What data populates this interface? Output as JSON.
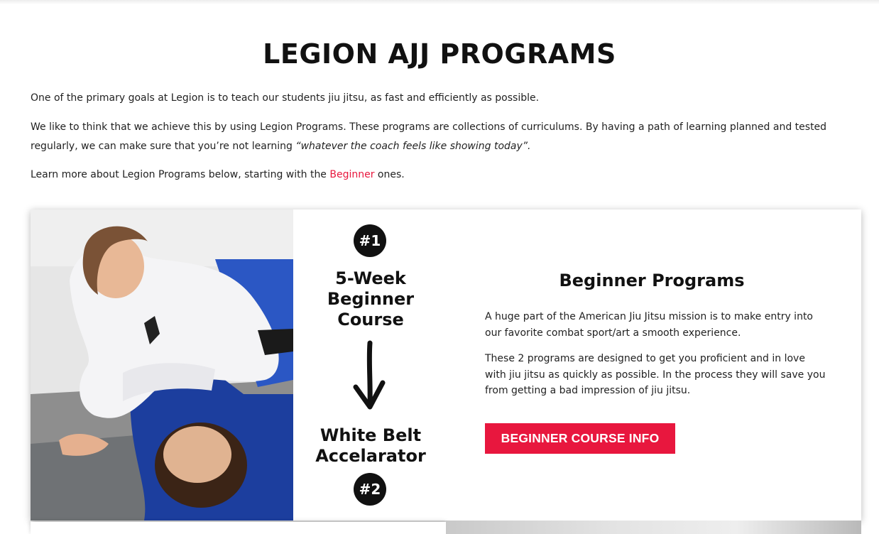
{
  "page": {
    "title": "LEGION AJJ PROGRAMS"
  },
  "intro": {
    "p1": "One of the primary goals at Legion is to teach our students jiu jitsu, as fast and efficiently as possible.",
    "p2_plain": "We like to think that we achieve this by using Legion Programs. These programs are collections of curriculums. By having a path of learning planned and tested regularly, we can make sure that you’re not learning ",
    "p2_quote": "“whatever the coach feels like showing today”.",
    "p3_before": "Learn more about Legion Programs below, starting with the ",
    "p3_link": "Beginner",
    "p3_after": " ones."
  },
  "card": {
    "badge_top": "#1",
    "course_top": "5-Week Beginner Course",
    "course_bottom": "White Belt Accelarator",
    "badge_bottom": "#2",
    "heading": "Beginner Programs",
    "para1": "A huge part of the American Jiu Jitsu mission is to make entry into our favorite combat sport/art a smooth experience.",
    "para2": "These 2 programs are designed to get you proficient and in love with jiu jitsu as quickly as possible. In the process they will save you from getting a bad impression of jiu jitsu.",
    "button_label": "BEGINNER COURSE INFO"
  },
  "colors": {
    "accent": "#e8173e",
    "text": "#222222",
    "dark": "#111111"
  },
  "icons": {
    "arrow": "down-arrow-icon"
  }
}
